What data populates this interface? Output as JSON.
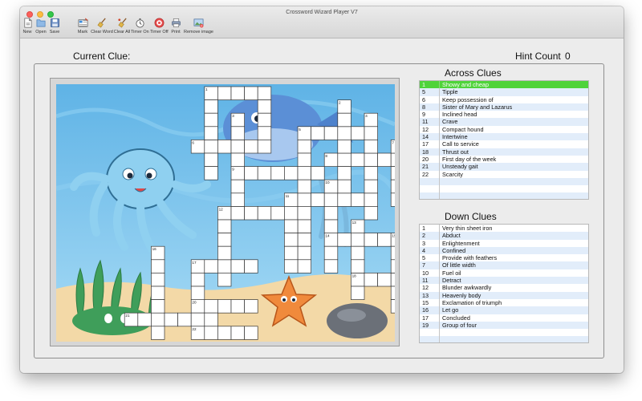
{
  "window": {
    "title": "Crossword Wizard Player V7"
  },
  "toolbar": {
    "new": "New",
    "open": "Open",
    "save": "Save",
    "mark": "Mark",
    "clear_word": "Clear Word",
    "clear_all": "Clear All",
    "timer_on": "Timer On",
    "timer_off": "Timer Off",
    "print": "Print",
    "remove_image": "Remove image"
  },
  "header": {
    "current_clue_label": "Current Clue:",
    "current_clue_value": "",
    "hint_label": "Hint Count",
    "hint_value": "0"
  },
  "across": {
    "title": "Across Clues",
    "selected_index": 0,
    "items": [
      {
        "num": "1",
        "text": "Showy and cheap"
      },
      {
        "num": "5",
        "text": "Tipple"
      },
      {
        "num": "6",
        "text": "Keep possession of"
      },
      {
        "num": "8",
        "text": "Sister of Mary and Lazarus"
      },
      {
        "num": "9",
        "text": "Inclined head"
      },
      {
        "num": "11",
        "text": "Crave"
      },
      {
        "num": "12",
        "text": "Compact hound"
      },
      {
        "num": "14",
        "text": "Intertwine"
      },
      {
        "num": "17",
        "text": "Call to service"
      },
      {
        "num": "18",
        "text": "Thrust out"
      },
      {
        "num": "20",
        "text": "First day of the week"
      },
      {
        "num": "21",
        "text": "Unsteady gait"
      },
      {
        "num": "22",
        "text": "Scarcity"
      }
    ]
  },
  "down": {
    "title": "Down Clues",
    "items": [
      {
        "num": "1",
        "text": "Very thin sheet iron"
      },
      {
        "num": "2",
        "text": "Abduct"
      },
      {
        "num": "3",
        "text": "Enlightenment"
      },
      {
        "num": "4",
        "text": "Confined"
      },
      {
        "num": "5",
        "text": "Provide with feathers"
      },
      {
        "num": "7",
        "text": "Of little width"
      },
      {
        "num": "10",
        "text": "Fuel oil"
      },
      {
        "num": "11",
        "text": "Detract"
      },
      {
        "num": "12",
        "text": "Blunder awkwardly"
      },
      {
        "num": "13",
        "text": "Heavenly body"
      },
      {
        "num": "15",
        "text": "Exclamation of triumph"
      },
      {
        "num": "16",
        "text": "Let go"
      },
      {
        "num": "17",
        "text": "Concluded"
      },
      {
        "num": "19",
        "text": "Group of four"
      }
    ]
  },
  "grid": {
    "numbers": [
      {
        "label": "1",
        "c": 8,
        "r": 0
      },
      {
        "label": "2",
        "c": 18,
        "r": 1
      },
      {
        "label": "3",
        "c": 10,
        "r": 2
      },
      {
        "label": "4",
        "c": 20,
        "r": 2
      },
      {
        "label": "5",
        "c": 15,
        "r": 3
      },
      {
        "label": "6",
        "c": 7,
        "r": 4
      },
      {
        "label": "7",
        "c": 22,
        "r": 4
      },
      {
        "label": "8",
        "c": 17,
        "r": 5
      },
      {
        "label": "9",
        "c": 10,
        "r": 6
      },
      {
        "label": "10",
        "c": 17,
        "r": 7
      },
      {
        "label": "11",
        "c": 14,
        "r": 8
      },
      {
        "label": "12",
        "c": 9,
        "r": 9
      },
      {
        "label": "13",
        "c": 19,
        "r": 10
      },
      {
        "label": "14",
        "c": 17,
        "r": 11
      },
      {
        "label": "15",
        "c": 22,
        "r": 11
      },
      {
        "label": "16",
        "c": 4,
        "r": 12
      },
      {
        "label": "17",
        "c": 7,
        "r": 13
      },
      {
        "label": "18",
        "c": 19,
        "r": 14
      },
      {
        "label": "19",
        "c": 24,
        "r": 14
      },
      {
        "label": "20",
        "c": 7,
        "r": 16
      },
      {
        "label": "21",
        "c": 2,
        "r": 17
      },
      {
        "label": "22",
        "c": 7,
        "r": 18
      }
    ]
  }
}
